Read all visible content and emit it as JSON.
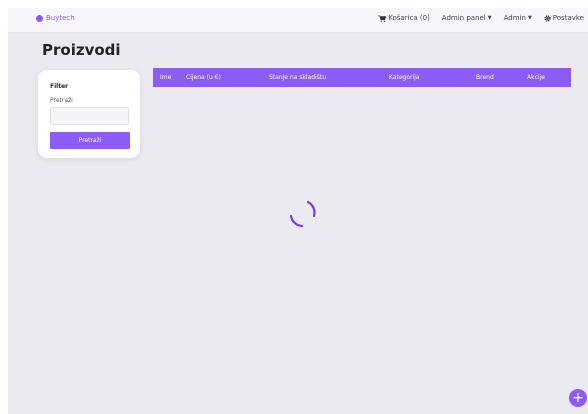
{
  "navbar": {
    "brand": "Buytech",
    "cart_label": "Košarica (0)",
    "admin_panel_label": "Admin panel",
    "admin_label": "Admin",
    "settings_label": "Postavke"
  },
  "page": {
    "title": "Proizvodi"
  },
  "filter": {
    "title": "Filter",
    "search_label": "Pretraži",
    "search_value": "",
    "search_button": "Pretraži"
  },
  "table": {
    "columns": [
      "Ime",
      "Cijena (u €)",
      "Stanje na skladištu",
      "Kategorija",
      "Brend",
      "Akcije"
    ]
  },
  "fab": {
    "icon": "plus-icon",
    "symbol": "+"
  },
  "colors": {
    "accent": "#8b5cf6",
    "background": "#eceaf1"
  }
}
